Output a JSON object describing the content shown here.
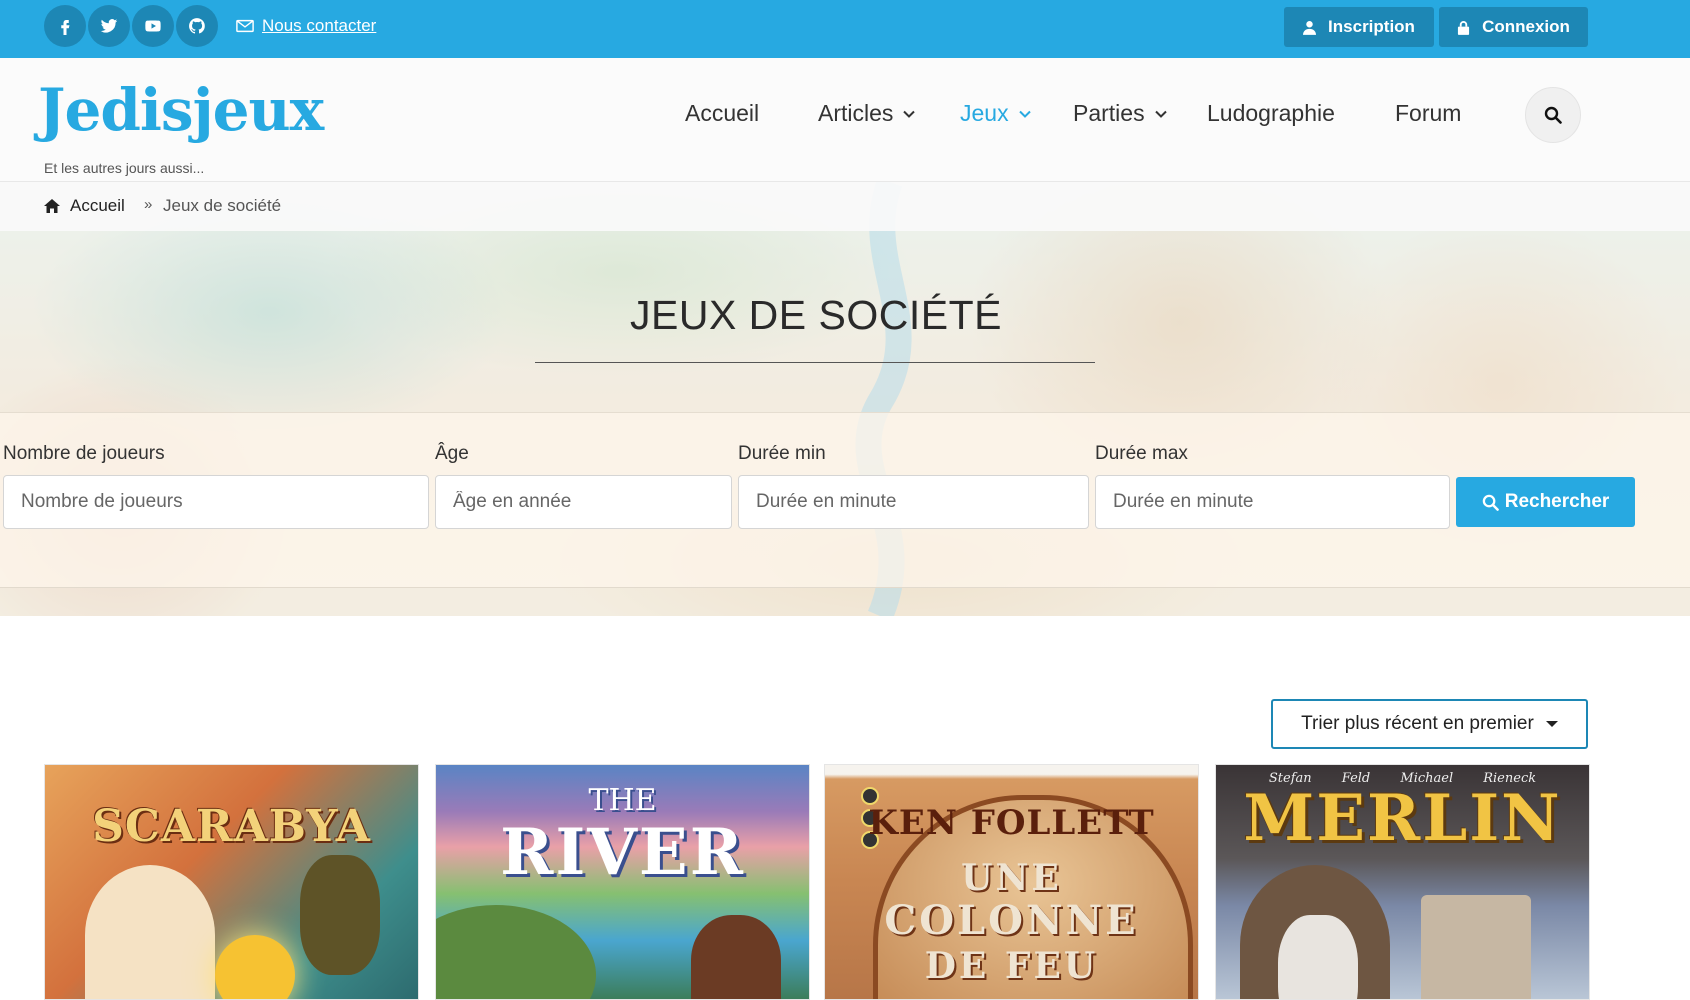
{
  "topbar": {
    "social": [
      "facebook-icon",
      "twitter-icon",
      "youtube-icon",
      "github-icon"
    ],
    "contact_label": "Nous contacter",
    "signup_label": "Inscription",
    "login_label": "Connexion"
  },
  "header": {
    "logo": "Jedisjeux",
    "tagline": "Et les autres jours aussi...",
    "nav": [
      {
        "label": "Accueil",
        "dropdown": false,
        "active": false
      },
      {
        "label": "Articles",
        "dropdown": true,
        "active": false
      },
      {
        "label": "Jeux",
        "dropdown": true,
        "active": true
      },
      {
        "label": "Parties",
        "dropdown": true,
        "active": false
      },
      {
        "label": "Ludographie",
        "dropdown": false,
        "active": false
      },
      {
        "label": "Forum",
        "dropdown": false,
        "active": false
      }
    ]
  },
  "breadcrumb": {
    "home": "Accueil",
    "separator": "»",
    "current": "Jeux de société"
  },
  "hero": {
    "title": "JEUX DE SOCIÉTÉ"
  },
  "filters": {
    "players": {
      "label": "Nombre de joueurs",
      "placeholder": "Nombre de joueurs",
      "value": ""
    },
    "age": {
      "label": "Âge",
      "placeholder": "Âge en année",
      "value": ""
    },
    "duration_min": {
      "label": "Durée min",
      "placeholder": "Durée en minute",
      "value": ""
    },
    "duration_max": {
      "label": "Durée max",
      "placeholder": "Durée en minute",
      "value": ""
    },
    "search_label": "Rechercher"
  },
  "sort": {
    "label": "Trier plus récent en premier"
  },
  "games": [
    {
      "title": "SCARABYA"
    },
    {
      "title_small": "THE",
      "title": "RIVER"
    },
    {
      "lines": [
        "KEN FOLLETT",
        "UNE",
        "COLONNE",
        "DE FEU"
      ]
    },
    {
      "credits": "Stefan Feld Michael Rieneck",
      "title": "MERLIN"
    }
  ],
  "colors": {
    "brand": "#27a9e1",
    "brand_dark": "#1d87b5"
  }
}
